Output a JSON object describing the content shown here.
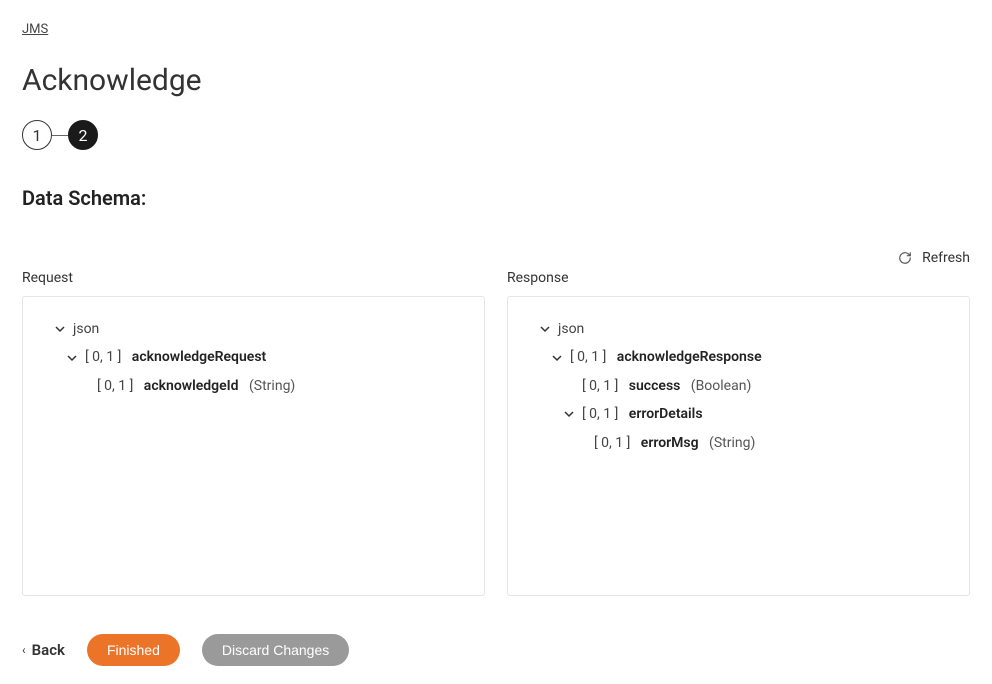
{
  "breadcrumb": "JMS",
  "page_title": "Acknowledge",
  "stepper": {
    "step1": "1",
    "step2": "2"
  },
  "section_title": "Data Schema:",
  "refresh_label": "Refresh",
  "request_label": "Request",
  "response_label": "Response",
  "request_tree": {
    "root": "json",
    "n1_card": "[ 0, 1 ]",
    "n1_name": "acknowledgeRequest",
    "n2_card": "[ 0, 1 ]",
    "n2_name": "acknowledgeId",
    "n2_type": "(String)"
  },
  "response_tree": {
    "root": "json",
    "n1_card": "[ 0, 1 ]",
    "n1_name": "acknowledgeResponse",
    "n2_card": "[ 0, 1 ]",
    "n2_name": "success",
    "n2_type": "(Boolean)",
    "n3_card": "[ 0, 1 ]",
    "n3_name": "errorDetails",
    "n4_card": "[ 0, 1 ]",
    "n4_name": "errorMsg",
    "n4_type": "(String)"
  },
  "footer": {
    "back": "Back",
    "finished": "Finished",
    "discard": "Discard Changes"
  }
}
